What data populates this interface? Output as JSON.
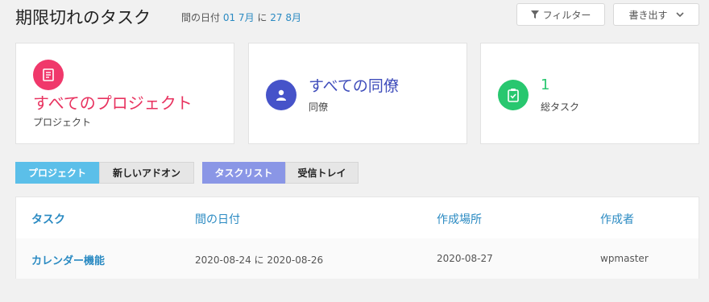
{
  "header": {
    "title": "期限切れのタスク",
    "date_prefix": "間の日付",
    "date_from": "01 7月",
    "date_conj": "に",
    "date_to": "27 8月",
    "filter_label": "フィルター",
    "export_label": "書き出す"
  },
  "cards": [
    {
      "icon": "project-icon",
      "value": "すべてのプロジェクト",
      "label": "プロジェクト",
      "color": "#f0386b"
    },
    {
      "icon": "user-icon",
      "value": "すべての同僚",
      "label": "同僚",
      "color": "#4653c9"
    },
    {
      "icon": "clipboard-check-icon",
      "value": "1",
      "label": "総タスク",
      "color": "#28c76f"
    }
  ],
  "tabs": {
    "projects": "プロジェクト",
    "addons": "新しいアドオン",
    "tasklist": "タスクリスト",
    "inbox": "受信トレイ"
  },
  "table": {
    "headers": [
      "タスク",
      "間の日付",
      "作成場所",
      "作成者"
    ],
    "rows": [
      [
        "カレンダー機能",
        "2020-08-24 に 2020-08-26",
        "2020-08-27",
        "wpmaster"
      ]
    ]
  }
}
